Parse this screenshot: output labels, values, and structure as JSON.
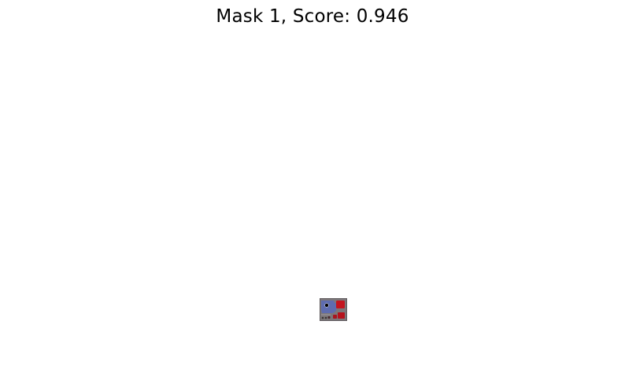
{
  "figure": {
    "title": "Mask 1, Score: 0.946"
  },
  "colors": {
    "background": "#ffffff",
    "board": "#7c777a",
    "mask_overlay": "#5b6bb3",
    "red_parts": "#c3151f",
    "prompt_point": "#000000"
  },
  "icons": {
    "prompt_point": "point-marker-icon"
  }
}
